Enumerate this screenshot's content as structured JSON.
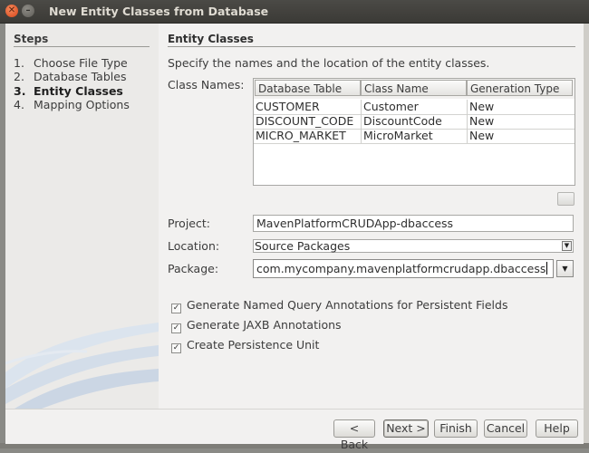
{
  "window": {
    "title": "New Entity Classes from Database"
  },
  "steps": {
    "title": "Steps",
    "items": [
      {
        "num": "1.",
        "label": "Choose File Type"
      },
      {
        "num": "2.",
        "label": "Database Tables"
      },
      {
        "num": "3.",
        "label": "Entity Classes"
      },
      {
        "num": "4.",
        "label": "Mapping Options"
      }
    ]
  },
  "content": {
    "title": "Entity Classes",
    "description": "Specify the names and the location of the entity classes.",
    "class_names_label": "Class Names:",
    "table": {
      "columns": [
        "Database Table",
        "Class Name",
        "Generation Type"
      ],
      "rows": [
        [
          "CUSTOMER",
          "Customer",
          "New"
        ],
        [
          "DISCOUNT_CODE",
          "DiscountCode",
          "New"
        ],
        [
          "MICRO_MARKET",
          "MicroMarket",
          "New"
        ]
      ]
    },
    "project_label": "Project:",
    "project_value": "MavenPlatformCRUDApp-dbaccess",
    "location_label": "Location:",
    "location_value": "Source Packages",
    "package_label": "Package:",
    "package_value": "com.mycompany.mavenplatformcrudapp.dbaccess",
    "options": [
      {
        "label": "Generate Named Query Annotations for Persistent Fields",
        "checked": true
      },
      {
        "label": "Generate JAXB Annotations",
        "checked": true
      },
      {
        "label": "Create Persistence Unit",
        "checked": true
      }
    ]
  },
  "buttons": {
    "back": "< Back",
    "next": "Next >",
    "finish": "Finish",
    "cancel": "Cancel",
    "help": "Help"
  },
  "icons": {
    "close": "close-icon",
    "minimize": "minimize-icon",
    "dropdown": "chevron-down-icon",
    "check": "checkmark"
  }
}
